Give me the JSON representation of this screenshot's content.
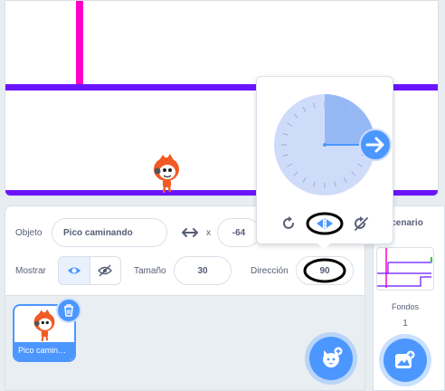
{
  "sprite": {
    "label": "Objeto",
    "name": "Pico caminando",
    "x_label": "x",
    "x_value": "-64",
    "show_label": "Mostrar",
    "size_label": "Tamaño",
    "size_value": "30",
    "direction_label": "Dirección",
    "direction_value": "90"
  },
  "sprite_list": {
    "items": [
      {
        "name": "Pico caminando"
      }
    ]
  },
  "stage_pane": {
    "label": "Escenario",
    "backdrops_label": "Fondos",
    "backdrops_count": "1"
  },
  "direction_popover": {
    "direction": 90,
    "modes": [
      "rotate-all-around-icon",
      "left-right-icon",
      "dont-rotate-icon"
    ],
    "selected_mode": "left-right"
  },
  "colors": {
    "accent": "#4c97ff",
    "wall": "#ff00cc",
    "ground": "#6b14ff",
    "sprite_orange": "#f15a24"
  }
}
